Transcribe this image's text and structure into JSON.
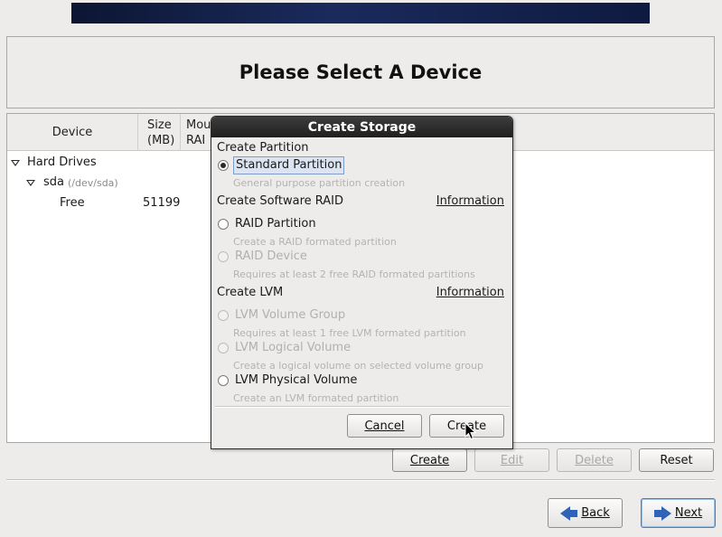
{
  "page_title": "Please Select A Device",
  "tree": {
    "columns": {
      "device": "Device",
      "size": "Size\n(MB)",
      "size_line1": "Size",
      "size_line2": "(MB)",
      "mount_line1": "Mou",
      "mount_line2": "RAI"
    },
    "group_label": "Hard Drives",
    "disk_name": "sda",
    "disk_path": "(/dev/sda)",
    "free_label": "Free",
    "free_size": "51199"
  },
  "actions": {
    "create": "Create",
    "edit": "Edit",
    "delete": "Delete",
    "reset": "Reset"
  },
  "nav": {
    "back": "Back",
    "next": "Next"
  },
  "dialog": {
    "title": "Create Storage",
    "create_partition_heading": "Create Partition",
    "standard_partition": {
      "label": "Standard Partition",
      "desc": "General purpose partition creation",
      "checked": true
    },
    "software_raid_heading": "Create Software RAID",
    "raid_info": "Information",
    "raid_partition": {
      "label": "RAID Partition",
      "desc": "Create a RAID formated partition"
    },
    "raid_device": {
      "label": "RAID Device",
      "desc": "Requires at least 2 free RAID formated partitions"
    },
    "lvm_heading": "Create LVM",
    "lvm_info": "Information",
    "lvm_volume_group": {
      "label": "LVM Volume Group",
      "desc": "Requires at least 1 free LVM formated partition"
    },
    "lvm_logical_volume": {
      "label": "LVM Logical Volume",
      "desc": "Create a logical volume on selected volume group"
    },
    "lvm_physical_volume": {
      "label": "LVM Physical Volume",
      "desc": "Create an LVM formated partition"
    },
    "cancel": "Cancel",
    "create": "Create"
  },
  "colors": {
    "banner": "#0c1633",
    "dialog_titlebar": "#1f1f1f",
    "nav_arrow": "#2f63b8"
  }
}
